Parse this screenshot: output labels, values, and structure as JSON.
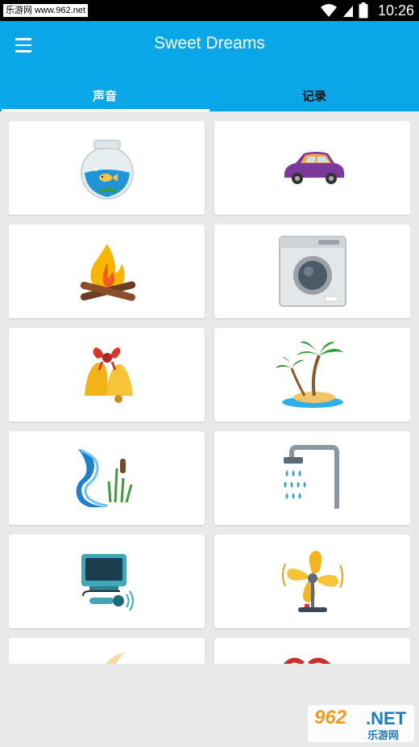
{
  "status_bar": {
    "watermark_text": "乐游网 www.962.net",
    "time": "10:26",
    "icons": [
      "wifi-icon",
      "signal-icon",
      "battery-icon"
    ]
  },
  "header": {
    "title": "Sweet Dreams",
    "menu_icon": "hamburger-menu-icon",
    "background_color": "#0aa7e8"
  },
  "tabs": [
    {
      "label": "声音",
      "active": true
    },
    {
      "label": "记录",
      "active": false
    }
  ],
  "sound_tiles": [
    {
      "icon": "fishbowl-icon"
    },
    {
      "icon": "car-icon"
    },
    {
      "icon": "campfire-icon"
    },
    {
      "icon": "washing-machine-icon"
    },
    {
      "icon": "bell-icon"
    },
    {
      "icon": "palm-island-icon"
    },
    {
      "icon": "stream-icon"
    },
    {
      "icon": "shower-icon"
    },
    {
      "icon": "tv-microphone-icon"
    },
    {
      "icon": "fan-icon"
    },
    {
      "icon": "partial-icon-1"
    },
    {
      "icon": "partial-icon-2"
    }
  ],
  "watermark": {
    "number": "962",
    "suffix": ".NET",
    "chinese": "乐游网"
  }
}
